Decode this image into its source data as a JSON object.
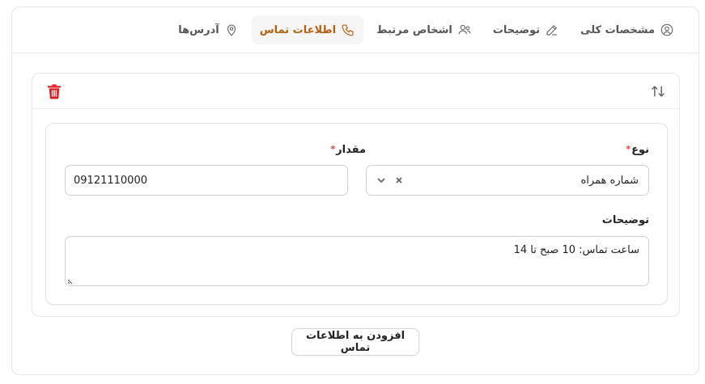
{
  "tabs": [
    {
      "label": "مشخصات کلی",
      "icon": "user-circle-icon",
      "active": false
    },
    {
      "label": "توضیحات",
      "icon": "edit-icon",
      "active": false
    },
    {
      "label": "اشخاص مرتبط",
      "icon": "users-icon",
      "active": false
    },
    {
      "label": "اطلاعات تماس",
      "icon": "phone-icon",
      "active": true
    },
    {
      "label": "آدرس‌ها",
      "icon": "map-pin-icon",
      "active": false
    }
  ],
  "section": {
    "sort_icon": "arrows-up-down-icon",
    "delete_icon": "trash-icon"
  },
  "form": {
    "type_label": "نوع",
    "type_value": "شماره همراه",
    "value_label": "مقدار",
    "value_value": "09121110000",
    "description_label": "توضیحات",
    "description_value": "ساعت تماس: 10 صبح تا 14",
    "required_mark": "*"
  },
  "add_button_label": "افزودن به اطلاعات تماس",
  "colors": {
    "accent": "#b5600c",
    "danger": "#e0191c",
    "required": "#e53935"
  }
}
